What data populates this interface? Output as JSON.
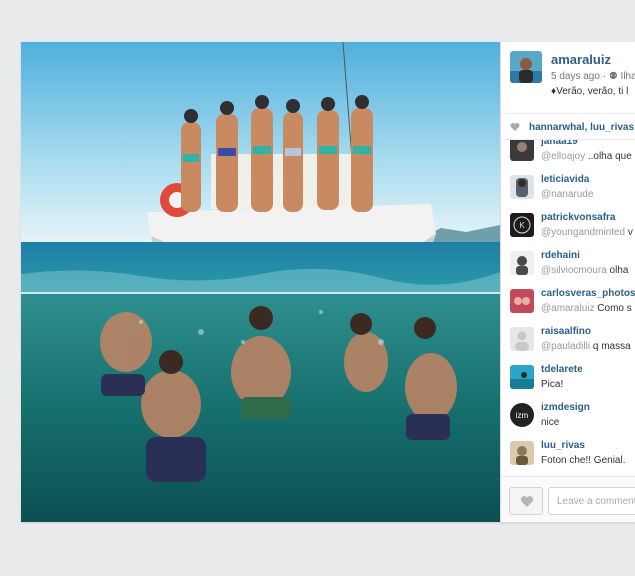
{
  "post": {
    "owner": {
      "username": "amaraluiz",
      "meta": "5 days ago · ⚉ Ilha",
      "caption": "♦Verão, verão, ti l"
    },
    "likes": {
      "names": "hannarwhal, luu_rivas"
    },
    "comments": [
      {
        "user": "janaa19",
        "mention": "@elloajoy",
        "text": " ..olha que",
        "avatar_color": "#3a3a3a"
      },
      {
        "user": "leticiavida",
        "mention": "@nanarude",
        "text": "",
        "avatar_color": "#556070"
      },
      {
        "user": "patrickvonsafra",
        "mention": "@youngandminted",
        "text": " v",
        "avatar_color": "#1c1c1c"
      },
      {
        "user": "rdehaini",
        "mention": "@silviocmoura",
        "text": " olha",
        "avatar_color": "#4a4a4a"
      },
      {
        "user": "carlosveras_photos",
        "mention": "@amaraluiz",
        "text": " Como s",
        "avatar_color": "#c24a5a"
      },
      {
        "user": "raisaalfino",
        "mention": "@pauladilli",
        "text": " q massa",
        "avatar_color": "#e6e6e6"
      },
      {
        "user": "tdelarete",
        "mention": "",
        "text": "Pica!",
        "avatar_color": "#2aa6c8"
      },
      {
        "user": "izmdesign",
        "mention": "",
        "text": "nice",
        "avatar_color": "#222222",
        "avatar_text": "izm"
      },
      {
        "user": "luu_rivas",
        "mention": "",
        "text": "Foton che!! Genial.",
        "avatar_color": "#8a7a5a"
      }
    ],
    "composer": {
      "placeholder": "Leave a comment..."
    }
  },
  "colors": {
    "link": "#2b5f8a",
    "background": "#e9eaec"
  }
}
